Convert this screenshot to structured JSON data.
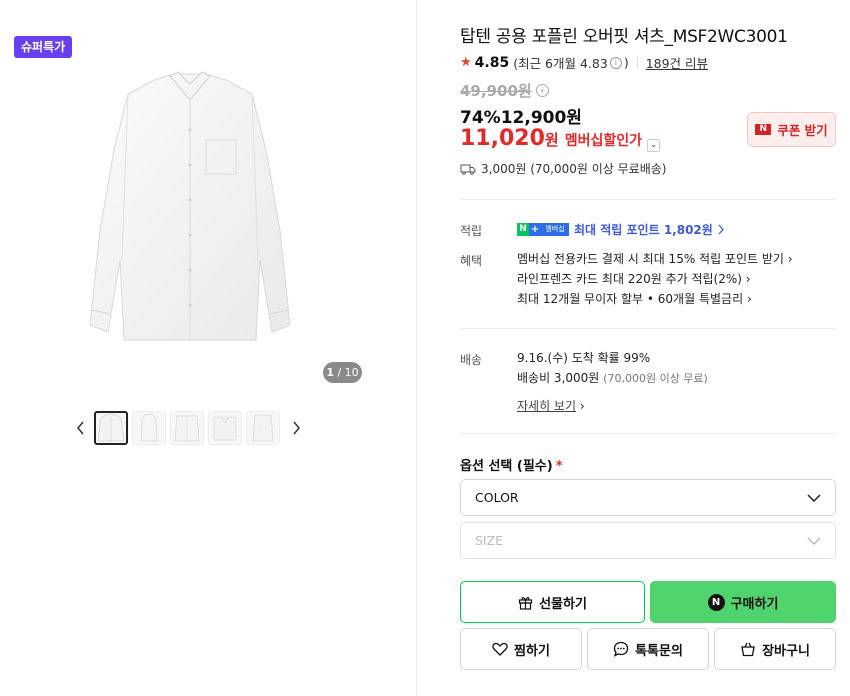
{
  "gallery": {
    "badge": "슈퍼특가",
    "counter_current": "1",
    "counter_total": "/ 10",
    "thumbnails": [
      "thumb-1",
      "thumb-2",
      "thumb-3",
      "thumb-4",
      "thumb-5"
    ]
  },
  "product": {
    "title": "탑텐 공용 포플린 오버핏 셔츠_MSF2WC3001",
    "rating": "4.85",
    "rating_recent": "(최근 6개월 4.83",
    "rating_recent_close": ")",
    "review_link": "189건 리뷰",
    "original_price": "49,900원",
    "discount_rate": "74%",
    "sale_price": "12,900원",
    "member_price": "11,020",
    "member_won": "원",
    "member_label": "멤버십할인가",
    "coupon_label": "쿠폰 받기",
    "shipping": "3,000원 (70,000원 이상 무료배송)"
  },
  "points": {
    "label": "적립",
    "badge_n": "N",
    "badge_plus": "+",
    "badge_m": "멤버십",
    "text": "최대 적립 포인트 1,802원"
  },
  "benefits": {
    "label": "혜택",
    "items": [
      "멤버십 전용카드 결제 시 최대 15% 적립 포인트 받기",
      "라인프렌즈 카드 최대 220원 추가 적립(2%)",
      "최대 12개월 무이자 할부 • 60개월 특별금리"
    ]
  },
  "delivery": {
    "label": "배송",
    "arrival": "9.16.(수) 도착 확률 99%",
    "fee": "배송비 3,000원",
    "fee_note": "(70,000원 이상 무료)",
    "detail_link": "자세히 보기"
  },
  "options": {
    "label": "옵션 선택 (필수)",
    "required_mark": "*",
    "color_placeholder": "COLOR",
    "size_placeholder": "SIZE"
  },
  "actions": {
    "gift": "선물하기",
    "buy": "구매하기",
    "buy_badge": "N",
    "wish": "찜하기",
    "talk": "톡톡문의",
    "cart": "장바구니"
  },
  "colors": {
    "badge": "#6a3ff2",
    "sale_red": "#e22a2a",
    "buy_green": "#4fd36d",
    "point_blue": "#3d5ad9"
  }
}
